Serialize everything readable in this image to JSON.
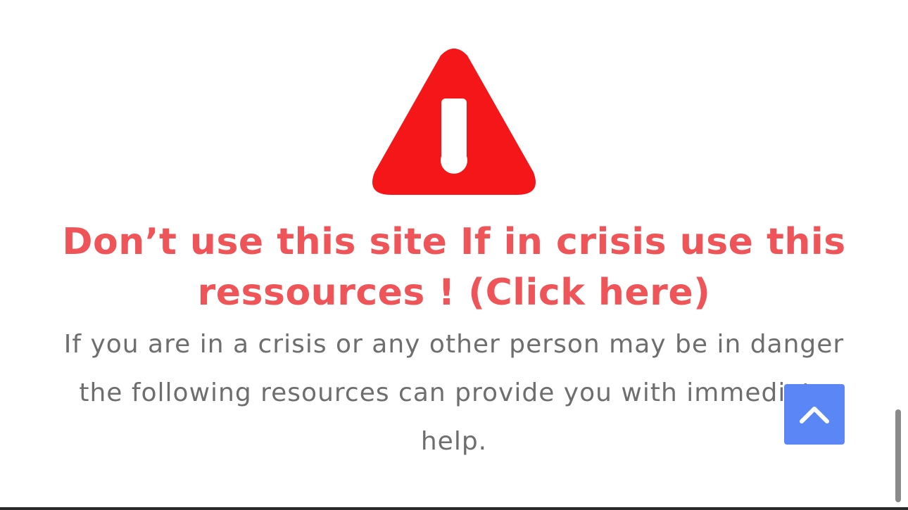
{
  "alert": {
    "icon": "warning-triangle-icon",
    "icon_color": "#f5161a",
    "headline": "Don’t use this site If in crisis use this ressources ! (Click here)",
    "headline_color": "#ef5458",
    "body": "If you are in a crisis or any other person may be in danger the following resources can provide you with immediate help.",
    "body_color": "#6e6e6e"
  },
  "back_to_top": {
    "icon": "chevron-up-icon",
    "color": "#5b86f5"
  },
  "scrollbar": {
    "thumb_color": "#8a8a8a"
  }
}
